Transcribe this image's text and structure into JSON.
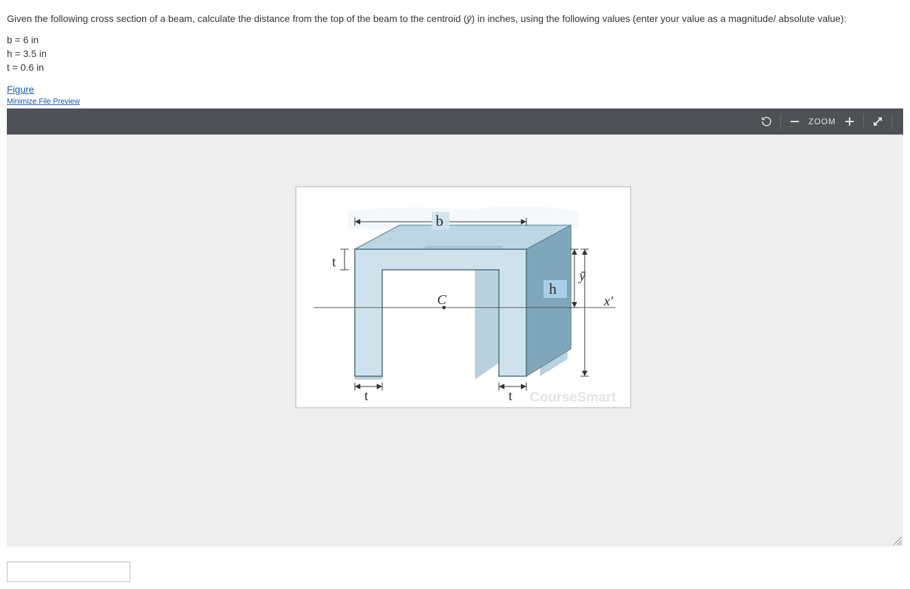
{
  "question": {
    "prompt_prefix": "Given the following cross section of a beam, calculate the distance from the top of the beam to the centroid (",
    "ybar": "ȳ",
    "prompt_suffix": ") in inches, using the following values (enter your value as a magnitude/ absolute value):"
  },
  "values": {
    "b": "b = 6 in",
    "h": "h = 3.5 in",
    "t": "t = 0.6 in"
  },
  "links": {
    "figure": "Figure",
    "minimize": "Minimize File Preview"
  },
  "toolbar": {
    "zoom_label": "ZOOM"
  },
  "figure": {
    "label_b": "b",
    "label_t_top": "t",
    "label_t_bottom_left": "t",
    "label_t_bottom_right": "t",
    "label_h": "h",
    "label_y": "ȳ",
    "label_x": "x'",
    "label_c": "C",
    "watermark": "CourseSmart"
  },
  "answer": {
    "value": "",
    "placeholder": ""
  }
}
